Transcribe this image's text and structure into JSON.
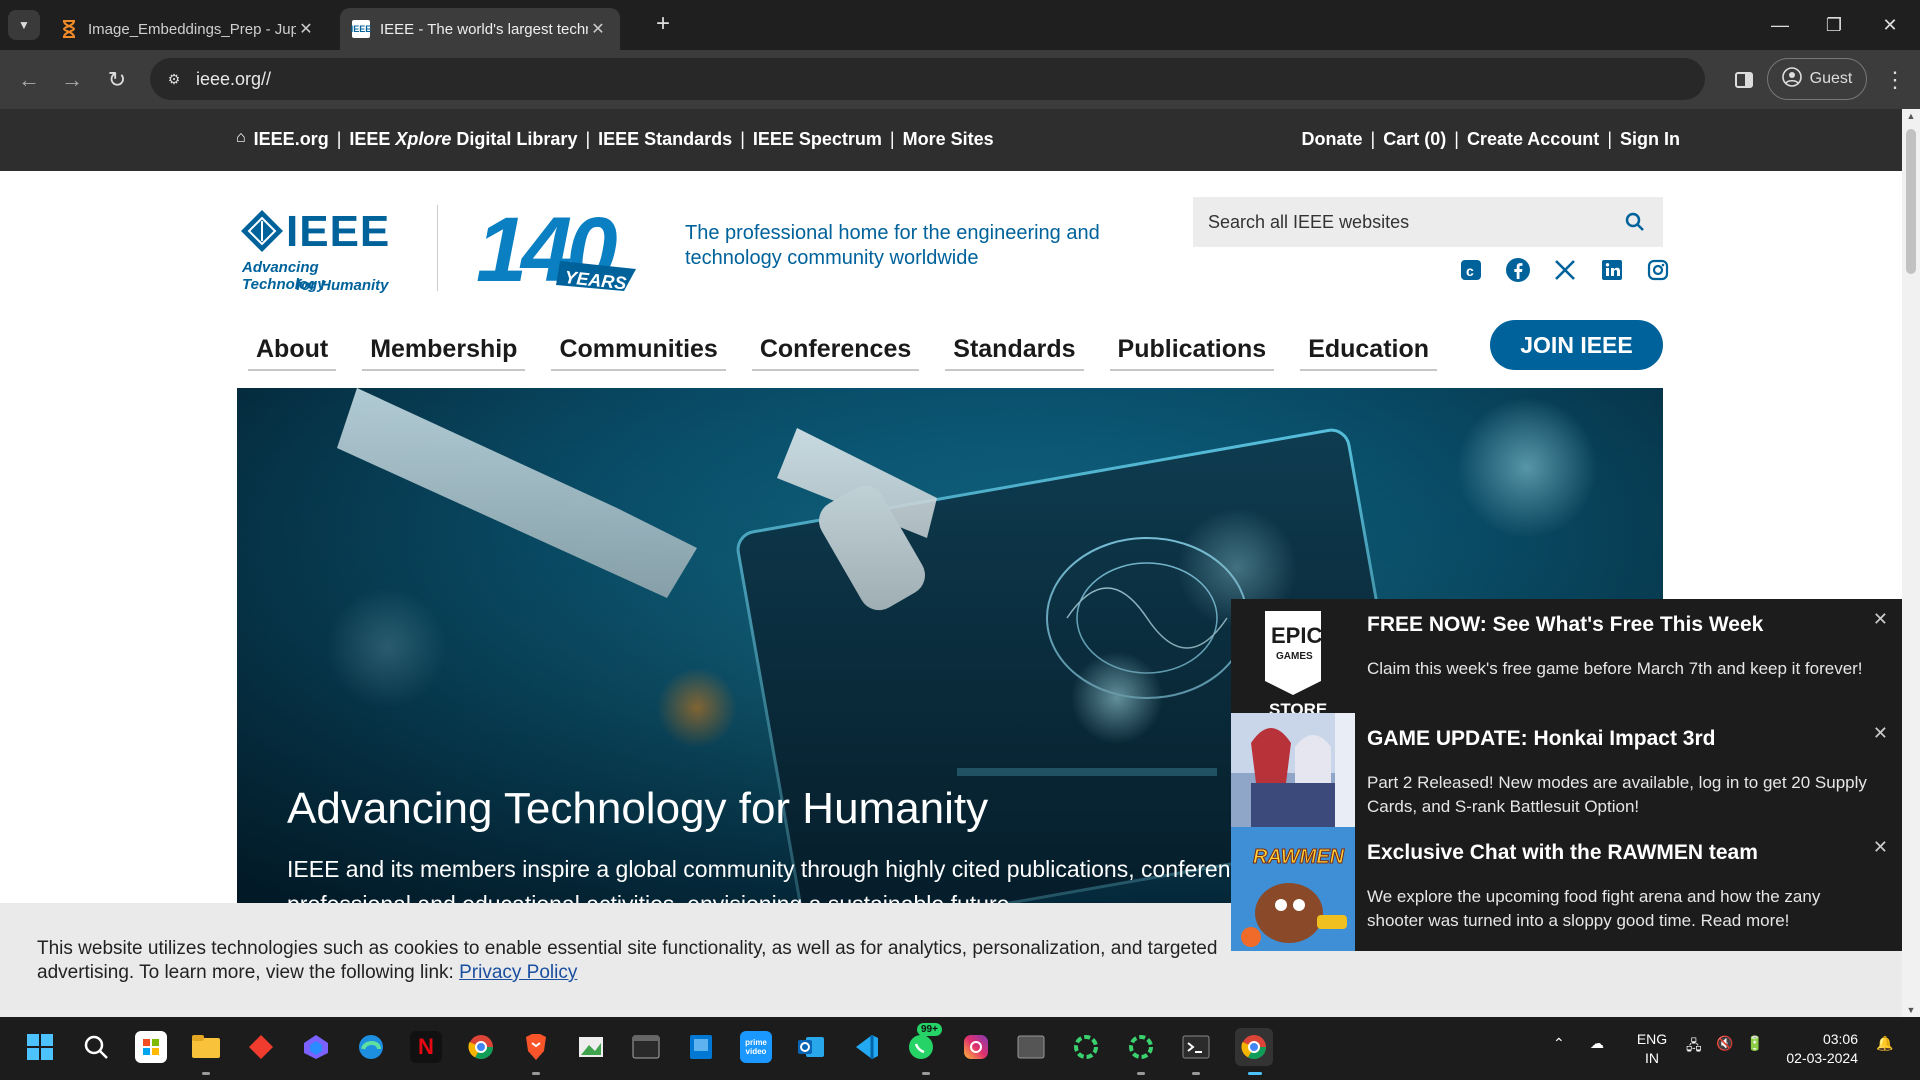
{
  "browser": {
    "tabs": [
      {
        "title": "Image_Embeddings_Prep - Jupyter",
        "favicon": "hourglass-icon",
        "active": false
      },
      {
        "title": "IEEE - The world's largest technical",
        "favicon": "ieee-favicon",
        "active": true
      }
    ],
    "url": "ieee.org//",
    "profile_label": "Guest"
  },
  "topbar": {
    "left_links": [
      {
        "label": "IEEE.org"
      },
      {
        "pre": "IEEE ",
        "em": "Xplore",
        "post": " Digital Library"
      },
      {
        "label": "IEEE Standards"
      },
      {
        "label": "IEEE Spectrum"
      },
      {
        "label": "More Sites"
      }
    ],
    "right_links": [
      "Donate",
      "Cart (0)",
      "Create Account",
      "Sign In"
    ]
  },
  "header": {
    "logo_word": "IEEE",
    "logo_tag_1": "Advancing Technology",
    "logo_tag_2": "for Humanity",
    "anniversary_number": "140",
    "anniversary_word": "YEARS",
    "tagline": "The professional home for the engineering and technology community worldwide",
    "search_placeholder": "Search all IEEE websites",
    "social": [
      "ieee-collabratec-icon",
      "facebook-icon",
      "x-icon",
      "linkedin-icon",
      "instagram-icon"
    ]
  },
  "nav": {
    "items": [
      "About",
      "Membership",
      "Communities",
      "Conferences",
      "Standards",
      "Publications",
      "Education"
    ],
    "join_label": "JOIN IEEE"
  },
  "hero": {
    "headline": "Advancing Technology for Humanity",
    "subtext": "IEEE and its members inspire a global community through highly cited publications, conferences, technology standards, and professional and educational activities, envisioning a sustainable future."
  },
  "cookie": {
    "text_1": "This website utilizes technologies such as cookies to enable essential site functionality, as well as for analytics, personalization, and targeted advertising. To learn",
    "text_2": "more, view the following link:",
    "link": "Privacy Policy"
  },
  "notifications": [
    {
      "title": "FREE NOW: See What's Free This Week",
      "body": "Claim this week's free game before March 7th and keep it forever!",
      "thumb": "epic-games-store-logo",
      "logo_top": "EPIC",
      "logo_mid": "GAMES",
      "logo_bottom": "STORE"
    },
    {
      "title": "GAME UPDATE: Honkai Impact 3rd",
      "body": "Part 2 Released! New modes are available, log in to get 20 Supply Cards, and S-rank Battlesuit Option!",
      "thumb": "honkai-impact-art"
    },
    {
      "title": "Exclusive Chat with the RAWMEN team",
      "body": "We explore the upcoming food fight arena and how the zany shooter was turned into a sloppy good time. Read more!",
      "thumb": "rawmen-art",
      "thumb_text": "RAWMEN"
    }
  ],
  "taskbar": {
    "apps": [
      "windows-start-icon",
      "search-icon",
      "microsoft-store-icon",
      "file-explorer-icon",
      "git-icon",
      "copilot-icon",
      "edge-icon",
      "netflix-icon",
      "chrome-icon",
      "brave-icon",
      "paint-icon",
      "terminal-icon",
      "windows-app-icon",
      "prime-video-icon",
      "outlook-icon",
      "vscode-icon",
      "whatsapp-icon",
      "instagram-icon",
      "window-icon",
      "spinner-icon",
      "spinner-icon-2",
      "powershell-icon",
      "chrome-active-icon"
    ],
    "netflix_label": "N",
    "prime_label": "prime video",
    "whatsapp_badge": "99+",
    "lang_1": "ENG",
    "lang_2": "IN",
    "time": "03:06",
    "date": "02-03-2024"
  },
  "colors": {
    "ieee_blue": "#00629b",
    "topbar_bg": "#2e2e2e",
    "notif_bg": "#1c1c1c"
  }
}
